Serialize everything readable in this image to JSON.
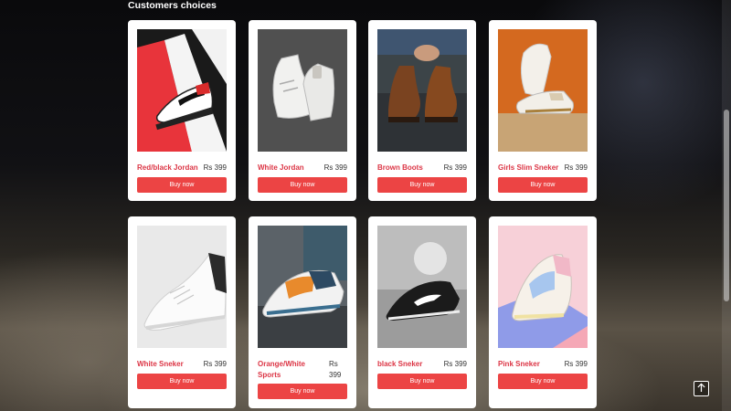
{
  "section": {
    "title": "Customers choices"
  },
  "products": [
    {
      "name": "Red/black Jordan",
      "price": "Rs 399",
      "button": "Buy now"
    },
    {
      "name": "White Jordan",
      "price": "Rs 399",
      "button": "Buy now"
    },
    {
      "name": "Brown Boots",
      "price": "Rs 399",
      "button": "Buy now"
    },
    {
      "name": "Girls Slim Sneker",
      "price": "Rs 399",
      "button": "Buy now"
    },
    {
      "name": "White Sneker",
      "price": "Rs 399",
      "button": "Buy now"
    },
    {
      "name": "Orange/White Sports",
      "price": "Rs 399",
      "button": "Buy now"
    },
    {
      "name": "black Sneker",
      "price": "Rs 399",
      "button": "Buy now"
    },
    {
      "name": "Pink Sneker",
      "price": "Rs 399",
      "button": "Buy now"
    }
  ],
  "icons": {
    "back_to_top": "arrow-up-icon"
  },
  "colors": {
    "accent": "#ec4444",
    "product_name": "#dc3545",
    "card": "#ffffff"
  }
}
